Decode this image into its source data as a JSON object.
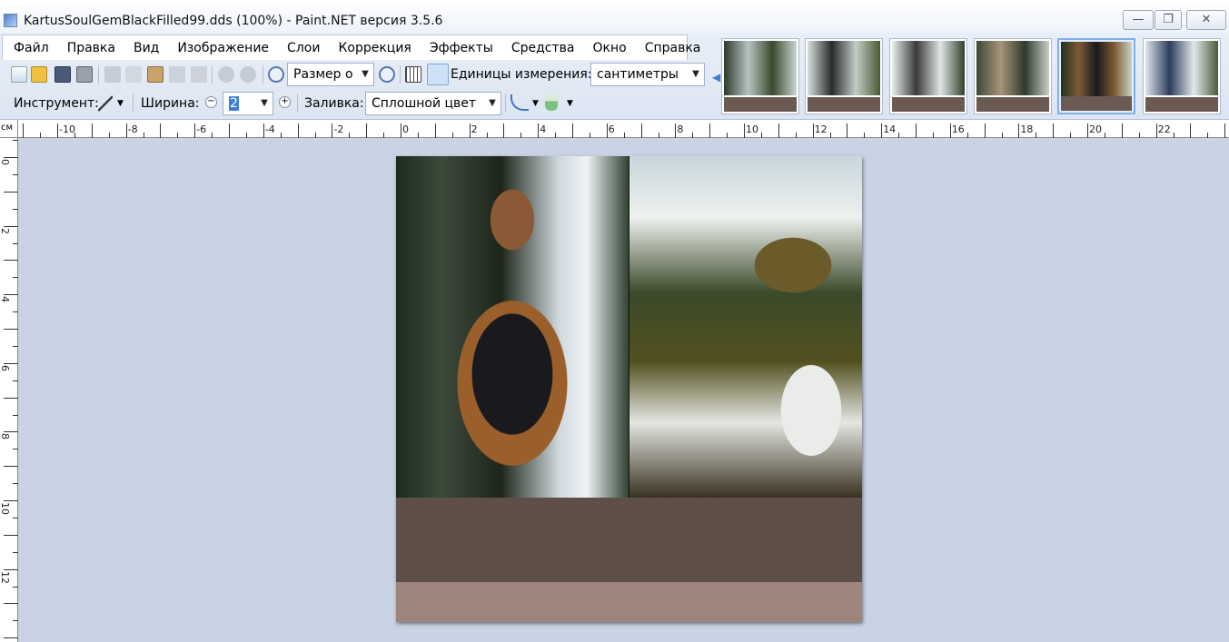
{
  "window": {
    "title": "KartusSoulGemBlackFilled99.dds (100%) - Paint.NET версия 3.5.6",
    "minimize": "—",
    "maximize": "❐",
    "close": "✕"
  },
  "menu": [
    "Файл",
    "Правка",
    "Вид",
    "Изображение",
    "Слои",
    "Коррекция",
    "Эффекты",
    "Средства",
    "Окно",
    "Справка"
  ],
  "toolbar": {
    "zoom_combo": "Размер о",
    "units_label": "Единицы измерения:",
    "units_value": "сантиметры"
  },
  "tool_options": {
    "tool_label": "Инструмент:",
    "width_label": "Ширина:",
    "width_value": "2",
    "fill_label": "Заливка:",
    "fill_value": "Сплошной цвет"
  },
  "ruler": {
    "unit": "см",
    "h_labels": [
      "-10",
      "-8",
      "-6",
      "-4",
      "-2",
      "0",
      "2",
      "4",
      "6",
      "8",
      "10",
      "12",
      "14",
      "16",
      "18",
      "20",
      "22"
    ],
    "v_labels": [
      "0",
      "2",
      "4",
      "6",
      "8",
      "10",
      "12"
    ]
  },
  "thumbnails": {
    "count": 6,
    "active_index": 4
  },
  "colors": {
    "workspace": "#c9d3e3",
    "band_dark": "#5f4f49",
    "band_light": "#9c857b"
  }
}
